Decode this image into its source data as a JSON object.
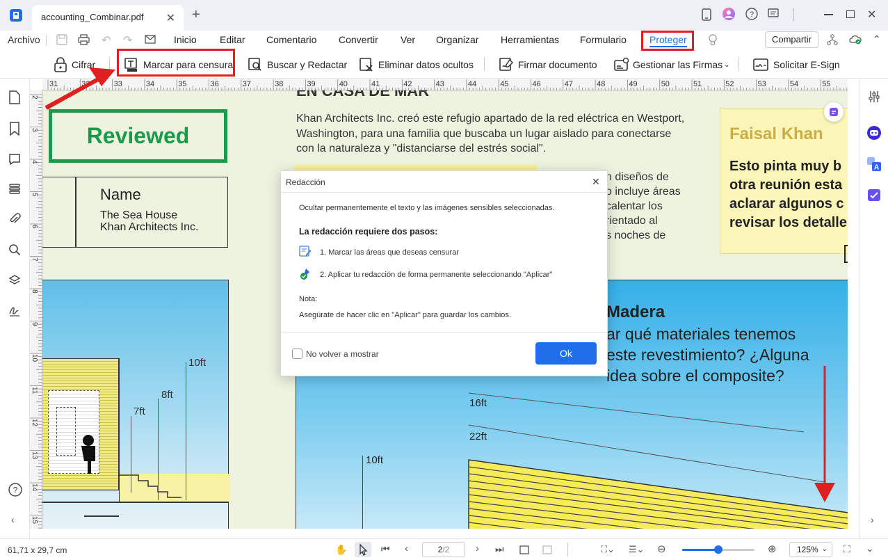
{
  "titlebar": {
    "tab_title": "accounting_Combinar.pdf",
    "add_tab": "+"
  },
  "menu": {
    "file": "Archivo",
    "items": [
      "Inicio",
      "Editar",
      "Comentario",
      "Convertir",
      "Ver",
      "Organizar",
      "Herramientas",
      "Formulario",
      "Proteger"
    ],
    "share": "Compartir"
  },
  "toolbar": {
    "encrypt": "Cifrar",
    "mark_redact": "Marcar para censura",
    "search_redact": "Buscar y Redactar",
    "remove_hidden": "Eliminar datos ocultos",
    "sign_doc": "Firmar documento",
    "manage_sign": "Gestionar las Firmas",
    "request_esign": "Solicitar E-Sign"
  },
  "ruler": {
    "h_ticks": [
      "31",
      "32",
      "33",
      "34",
      "35",
      "36",
      "37",
      "38",
      "39",
      "40",
      "41",
      "42",
      "43",
      "44",
      "45",
      "46",
      "47",
      "48",
      "49",
      "50",
      "51",
      "52",
      "53",
      "54",
      "55"
    ],
    "v_ticks": [
      "2",
      "3",
      "4",
      "5",
      "6",
      "7",
      "8",
      "9",
      "10",
      "11",
      "12",
      "13",
      "14",
      "15"
    ]
  },
  "document": {
    "stamp": "Reviewed",
    "heading_partial": "EN CASA DE MAR",
    "para1": "Khan Architects Inc. creó este refugio apartado de la red eléctrica en Westport, Washington, para una familia que buscaba un lugar aislado para conectarse con la naturaleza y \"distanciarse del estrés social\".",
    "para2_lines": [
      "n diseños de",
      "o incluye áreas",
      "calentar los",
      "rientado al",
      "s noches de"
    ],
    "name_label": "Name",
    "name_line1": "The Sea House",
    "name_line2": "Khan Architects Inc.",
    "note_author": "Faisal Khan",
    "note_lines": [
      "Esto pinta muy b",
      "otra reunión esta",
      "aclarar algunos c",
      "revisar los detalle"
    ],
    "madera_title": "Madera",
    "madera_lines": [
      "ar qué materiales tenemos",
      "este revestimiento? ¿Alguna",
      "idea sobre el composite?"
    ],
    "dims": [
      "10ft",
      "8ft",
      "7ft",
      "16ft",
      "22ft",
      "10ft"
    ]
  },
  "dialog": {
    "title": "Redacción",
    "intro": "Ocultar permanentemente el texto y las imágenes sensibles seleccionadas.",
    "steps_heading": "La redacción requiere dos pasos:",
    "step1": "1. Marcar las áreas que deseas censurar",
    "step2": "2. Aplicar tu redacción de forma permanente seleccionando \"Aplicar\"",
    "note_label": "Nota:",
    "note_text": "Asegúrate de hacer clic en \"Aplicar\" para guardar los cambios.",
    "dont_show": "No volver a mostrar",
    "ok": "Ok"
  },
  "status": {
    "page_size": "61,71 x 29,7 cm",
    "page_current": "2",
    "page_total": "/2",
    "zoom": "125%",
    "zoom_fraction": 0.5
  },
  "colors": {
    "accent": "#1f6fea",
    "highlight_red": "#e02020",
    "stamp_green": "#1a9a4a",
    "note_yellow": "#fbf5b8"
  }
}
